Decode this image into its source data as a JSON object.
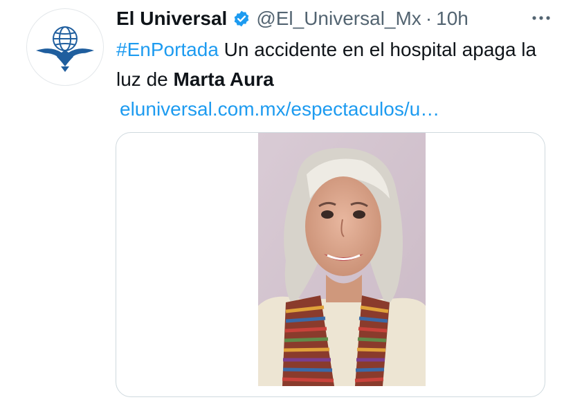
{
  "tweet": {
    "display_name": "El Universal",
    "handle": "@El_Universal_Mx",
    "separator": "·",
    "time": "10h",
    "text_parts": {
      "hashtag": "#EnPortada",
      "line_part1": " Un accidente en el hospital apaga la luz de ",
      "bold_name": "Marta Aura"
    },
    "link": "eluniversal.com.mx/espectaculos/u…"
  },
  "icons": {
    "avatar": "eagle-globe-logo-icon",
    "verified": "verified-badge-icon",
    "more": "more-horizontal-icon"
  },
  "colors": {
    "accent": "#1d9bf0",
    "text": "#0f1419",
    "secondary": "#536471",
    "card_border": "#cfd9de",
    "logo_blue": "#1f5e9e"
  }
}
